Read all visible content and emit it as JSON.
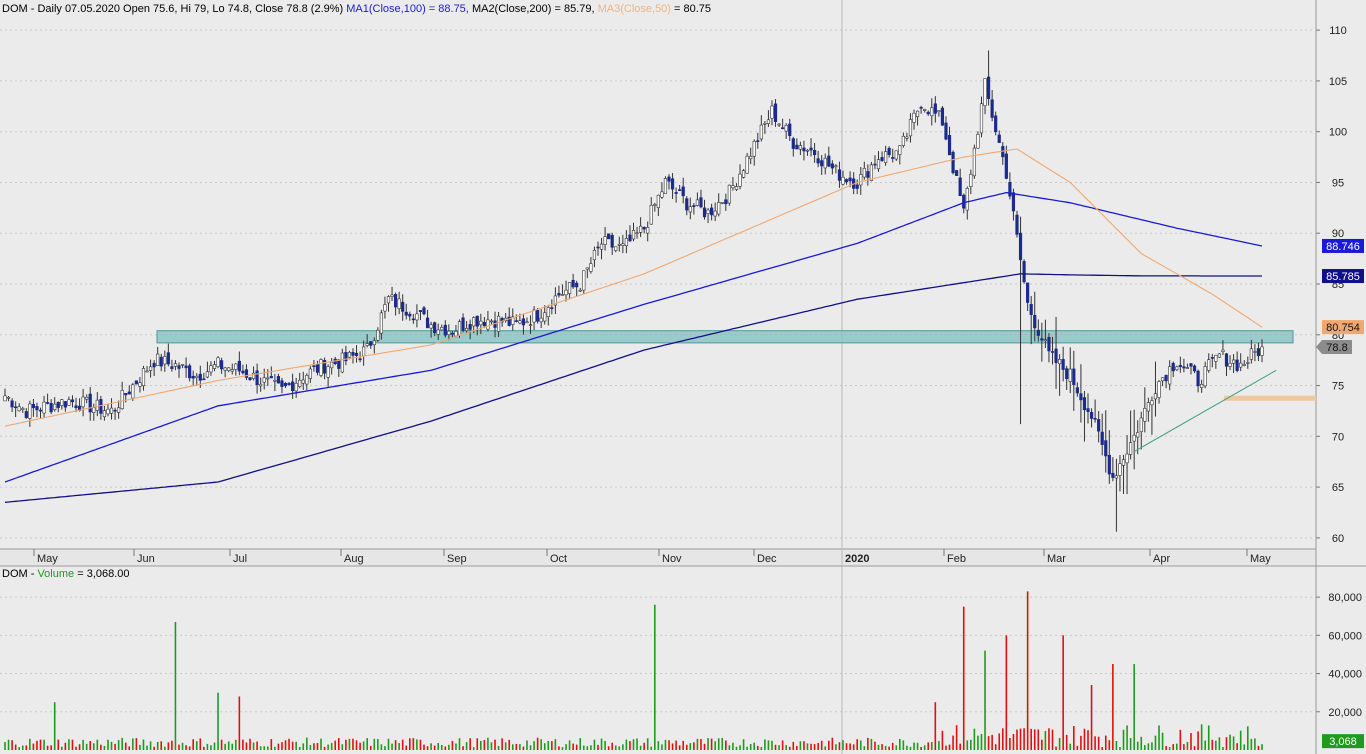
{
  "header": {
    "symbol": "DOM",
    "info": "DOM - Daily 07.05.2020 Open 75.6, Hi 79, Lo 74.8, Close 78.8 (2.9%)",
    "ma1": "MA1(Close,100) = 88.75,",
    "ma2": "MA2(Close,200) = 85.79,",
    "ma3_label": "MA3(Close,50)",
    "ma3_value": "= 80.75"
  },
  "volume_header": {
    "prefix": "DOM -",
    "label": "Volume",
    "value": "= 3,068.00"
  },
  "colors": {
    "background": "#ebebeb",
    "up_candle": "#ffffff",
    "down_candle": "#1b2b8c",
    "ma1": "#1a1ad6",
    "ma2": "#10108a",
    "ma3": "#f0a870",
    "zone": "#7fbfbf",
    "support": "#f0c8a0",
    "trendline": "#40a080",
    "volume_up": "#1f9a1f",
    "volume_down": "#e01010",
    "last_close_tag": "#606060",
    "volume_tag": "#1f9a1f"
  },
  "chart_data": [
    {
      "type": "candlestick",
      "title": "DOM - Daily",
      "ylim": [
        59,
        111
      ],
      "y_ticks": [
        60,
        65,
        70,
        75,
        80,
        85,
        90,
        95,
        100,
        105,
        110
      ],
      "x_labels": [
        "May",
        "Jun",
        "Jul",
        "Aug",
        "Sep",
        "Oct",
        "Nov",
        "Dec",
        "2020",
        "Feb",
        "Mar",
        "Apr",
        "May"
      ],
      "last_close": 78.8,
      "tags": [
        {
          "name": "MA1",
          "label": "88.746",
          "value": 88.746
        },
        {
          "name": "MA2",
          "label": "85.785",
          "value": 85.785
        },
        {
          "name": "MA3",
          "label": "80.754",
          "value": 80.754
        },
        {
          "name": "Close",
          "label": "78.8",
          "value": 78.8
        }
      ],
      "resistance_zone": [
        79.2,
        80.4
      ],
      "support_zone": [
        73.5,
        74.0
      ],
      "anchors": [
        [
          0,
          74.0
        ],
        [
          6,
          72.5
        ],
        [
          12,
          73.0
        ],
        [
          18,
          73.5
        ],
        [
          24,
          73.0
        ],
        [
          30,
          72.5
        ],
        [
          36,
          75.0
        ],
        [
          42,
          77.5
        ],
        [
          48,
          77.0
        ],
        [
          54,
          76.0
        ],
        [
          60,
          77.0
        ],
        [
          66,
          76.5
        ],
        [
          72,
          75.5
        ],
        [
          78,
          74.5
        ],
        [
          84,
          76.0
        ],
        [
          90,
          77.0
        ],
        [
          96,
          77.5
        ],
        [
          102,
          78.5
        ],
        [
          108,
          83.5
        ],
        [
          114,
          82.5
        ],
        [
          120,
          81.0
        ],
        [
          126,
          80.5
        ],
        [
          132,
          81.5
        ],
        [
          138,
          81.5
        ],
        [
          144,
          81.0
        ],
        [
          150,
          82.0
        ],
        [
          156,
          84.0
        ],
        [
          162,
          85.0
        ],
        [
          168,
          89.0
        ],
        [
          174,
          88.5
        ],
        [
          180,
          90.5
        ],
        [
          186,
          95.0
        ],
        [
          192,
          93.0
        ],
        [
          198,
          92.0
        ],
        [
          204,
          94.0
        ],
        [
          210,
          98.0
        ],
        [
          216,
          102.0
        ],
        [
          222,
          99.0
        ],
        [
          228,
          98.0
        ],
        [
          234,
          96.0
        ],
        [
          240,
          95.0
        ],
        [
          246,
          97.5
        ],
        [
          252,
          98.0
        ],
        [
          258,
          103.0
        ],
        [
          264,
          101.0
        ],
        [
          270,
          92.0
        ],
        [
          276,
          104.5
        ],
        [
          282,
          96.0
        ],
        [
          288,
          83.0
        ],
        [
          294,
          78.0
        ],
        [
          300,
          76.0
        ],
        [
          306,
          72.0
        ],
        [
          312,
          66.0
        ],
        [
          318,
          70.0
        ],
        [
          324,
          75.0
        ],
        [
          330,
          77.5
        ],
        [
          336,
          75.5
        ],
        [
          342,
          78.0
        ],
        [
          348,
          77.0
        ],
        [
          354,
          78.8
        ]
      ],
      "ma1_values": [
        [
          0,
          65.5
        ],
        [
          60,
          73.0
        ],
        [
          120,
          76.5
        ],
        [
          180,
          83.0
        ],
        [
          240,
          89.0
        ],
        [
          270,
          93.0
        ],
        [
          282,
          94.0
        ],
        [
          300,
          93.0
        ],
        [
          330,
          90.5
        ],
        [
          354,
          88.746
        ]
      ],
      "ma2_values": [
        [
          0,
          63.5
        ],
        [
          60,
          65.5
        ],
        [
          120,
          71.5
        ],
        [
          180,
          78.5
        ],
        [
          240,
          83.5
        ],
        [
          286,
          86.0
        ],
        [
          300,
          85.9
        ],
        [
          320,
          85.8
        ],
        [
          354,
          85.785
        ]
      ],
      "ma3_values": [
        [
          0,
          71.0
        ],
        [
          60,
          75.5
        ],
        [
          120,
          79.0
        ],
        [
          180,
          86.0
        ],
        [
          240,
          95.0
        ],
        [
          270,
          97.5
        ],
        [
          285,
          98.3
        ],
        [
          300,
          95.0
        ],
        [
          320,
          88.0
        ],
        [
          340,
          84.0
        ],
        [
          354,
          80.754
        ]
      ]
    },
    {
      "type": "bar",
      "title": "Volume",
      "ylim": [
        0,
        90000
      ],
      "y_ticks": [
        20000,
        40000,
        60000,
        80000
      ],
      "y_tick_labels": [
        "20,000",
        "40,000",
        "60,000",
        "80,000"
      ],
      "last_value": 3068,
      "last_label": "3,068",
      "spikes": [
        [
          14,
          25000
        ],
        [
          48,
          67000
        ],
        [
          60,
          30000
        ],
        [
          66,
          28000
        ],
        [
          183,
          76000
        ],
        [
          262,
          25000
        ],
        [
          270,
          75000
        ],
        [
          276,
          52000
        ],
        [
          282,
          60000
        ],
        [
          288,
          83000
        ],
        [
          298,
          60000
        ],
        [
          306,
          34000
        ],
        [
          312,
          45000
        ],
        [
          318,
          45000
        ]
      ]
    }
  ]
}
